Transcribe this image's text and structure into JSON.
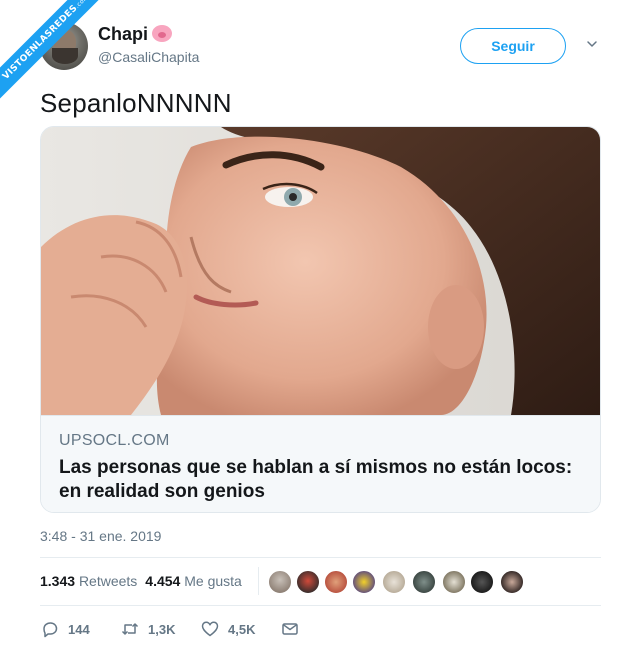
{
  "watermark": {
    "text": "VISTOENLASREDES",
    "suffix": ".com"
  },
  "author": {
    "name": "Chapi",
    "handle": "@CasaliChapita",
    "emoji": "pig-face-icon"
  },
  "follow_button": {
    "label": "Seguir"
  },
  "tweet": {
    "text": "SepanloNNNNN",
    "timestamp": "3:48 - 31 ene. 2019"
  },
  "card": {
    "domain": "UPSOCL.COM",
    "title": "Las personas que se hablan a sí mismos no están locos: en realidad son genios"
  },
  "stats": {
    "retweets_count": "1.343",
    "retweets_label": "Retweets",
    "likes_count": "4.454",
    "likes_label": "Me gusta"
  },
  "actions": {
    "replies": "144",
    "retweets": "1,3K",
    "likes": "4,5K"
  },
  "colors": {
    "accent": "#1da1f2",
    "secondary_text": "#657786",
    "primary_text": "#14171a"
  }
}
